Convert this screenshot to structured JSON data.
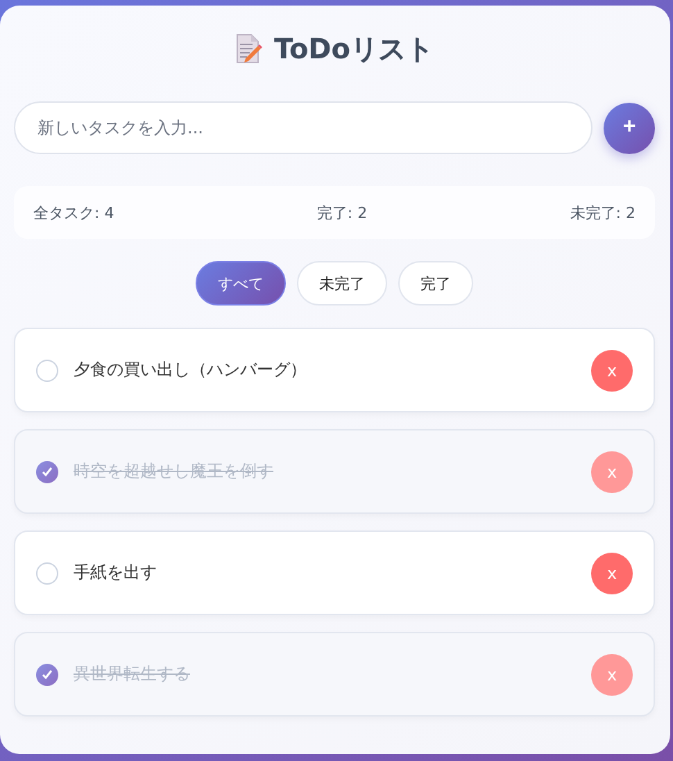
{
  "title": "ToDoリスト",
  "new_task": {
    "placeholder": "新しいタスクを入力...",
    "add_label": "+"
  },
  "stats": [
    {
      "text": "全タスク: 4"
    },
    {
      "text": "完了: 2"
    },
    {
      "text": "未完了: 2"
    }
  ],
  "filters": [
    {
      "label": "すべて",
      "selected": true
    },
    {
      "label": "未完了",
      "selected": false
    },
    {
      "label": "完了",
      "selected": false
    }
  ],
  "tasks": [
    {
      "text": "夕食の買い出し（ハンバーグ）",
      "done": false,
      "delete_label": "x"
    },
    {
      "text": "時空を超越せし魔王を倒す",
      "done": true,
      "delete_label": "x"
    },
    {
      "text": "手紙を出す",
      "done": false,
      "delete_label": "x"
    },
    {
      "text": "異世界転生する",
      "done": true,
      "delete_label": "x"
    }
  ]
}
